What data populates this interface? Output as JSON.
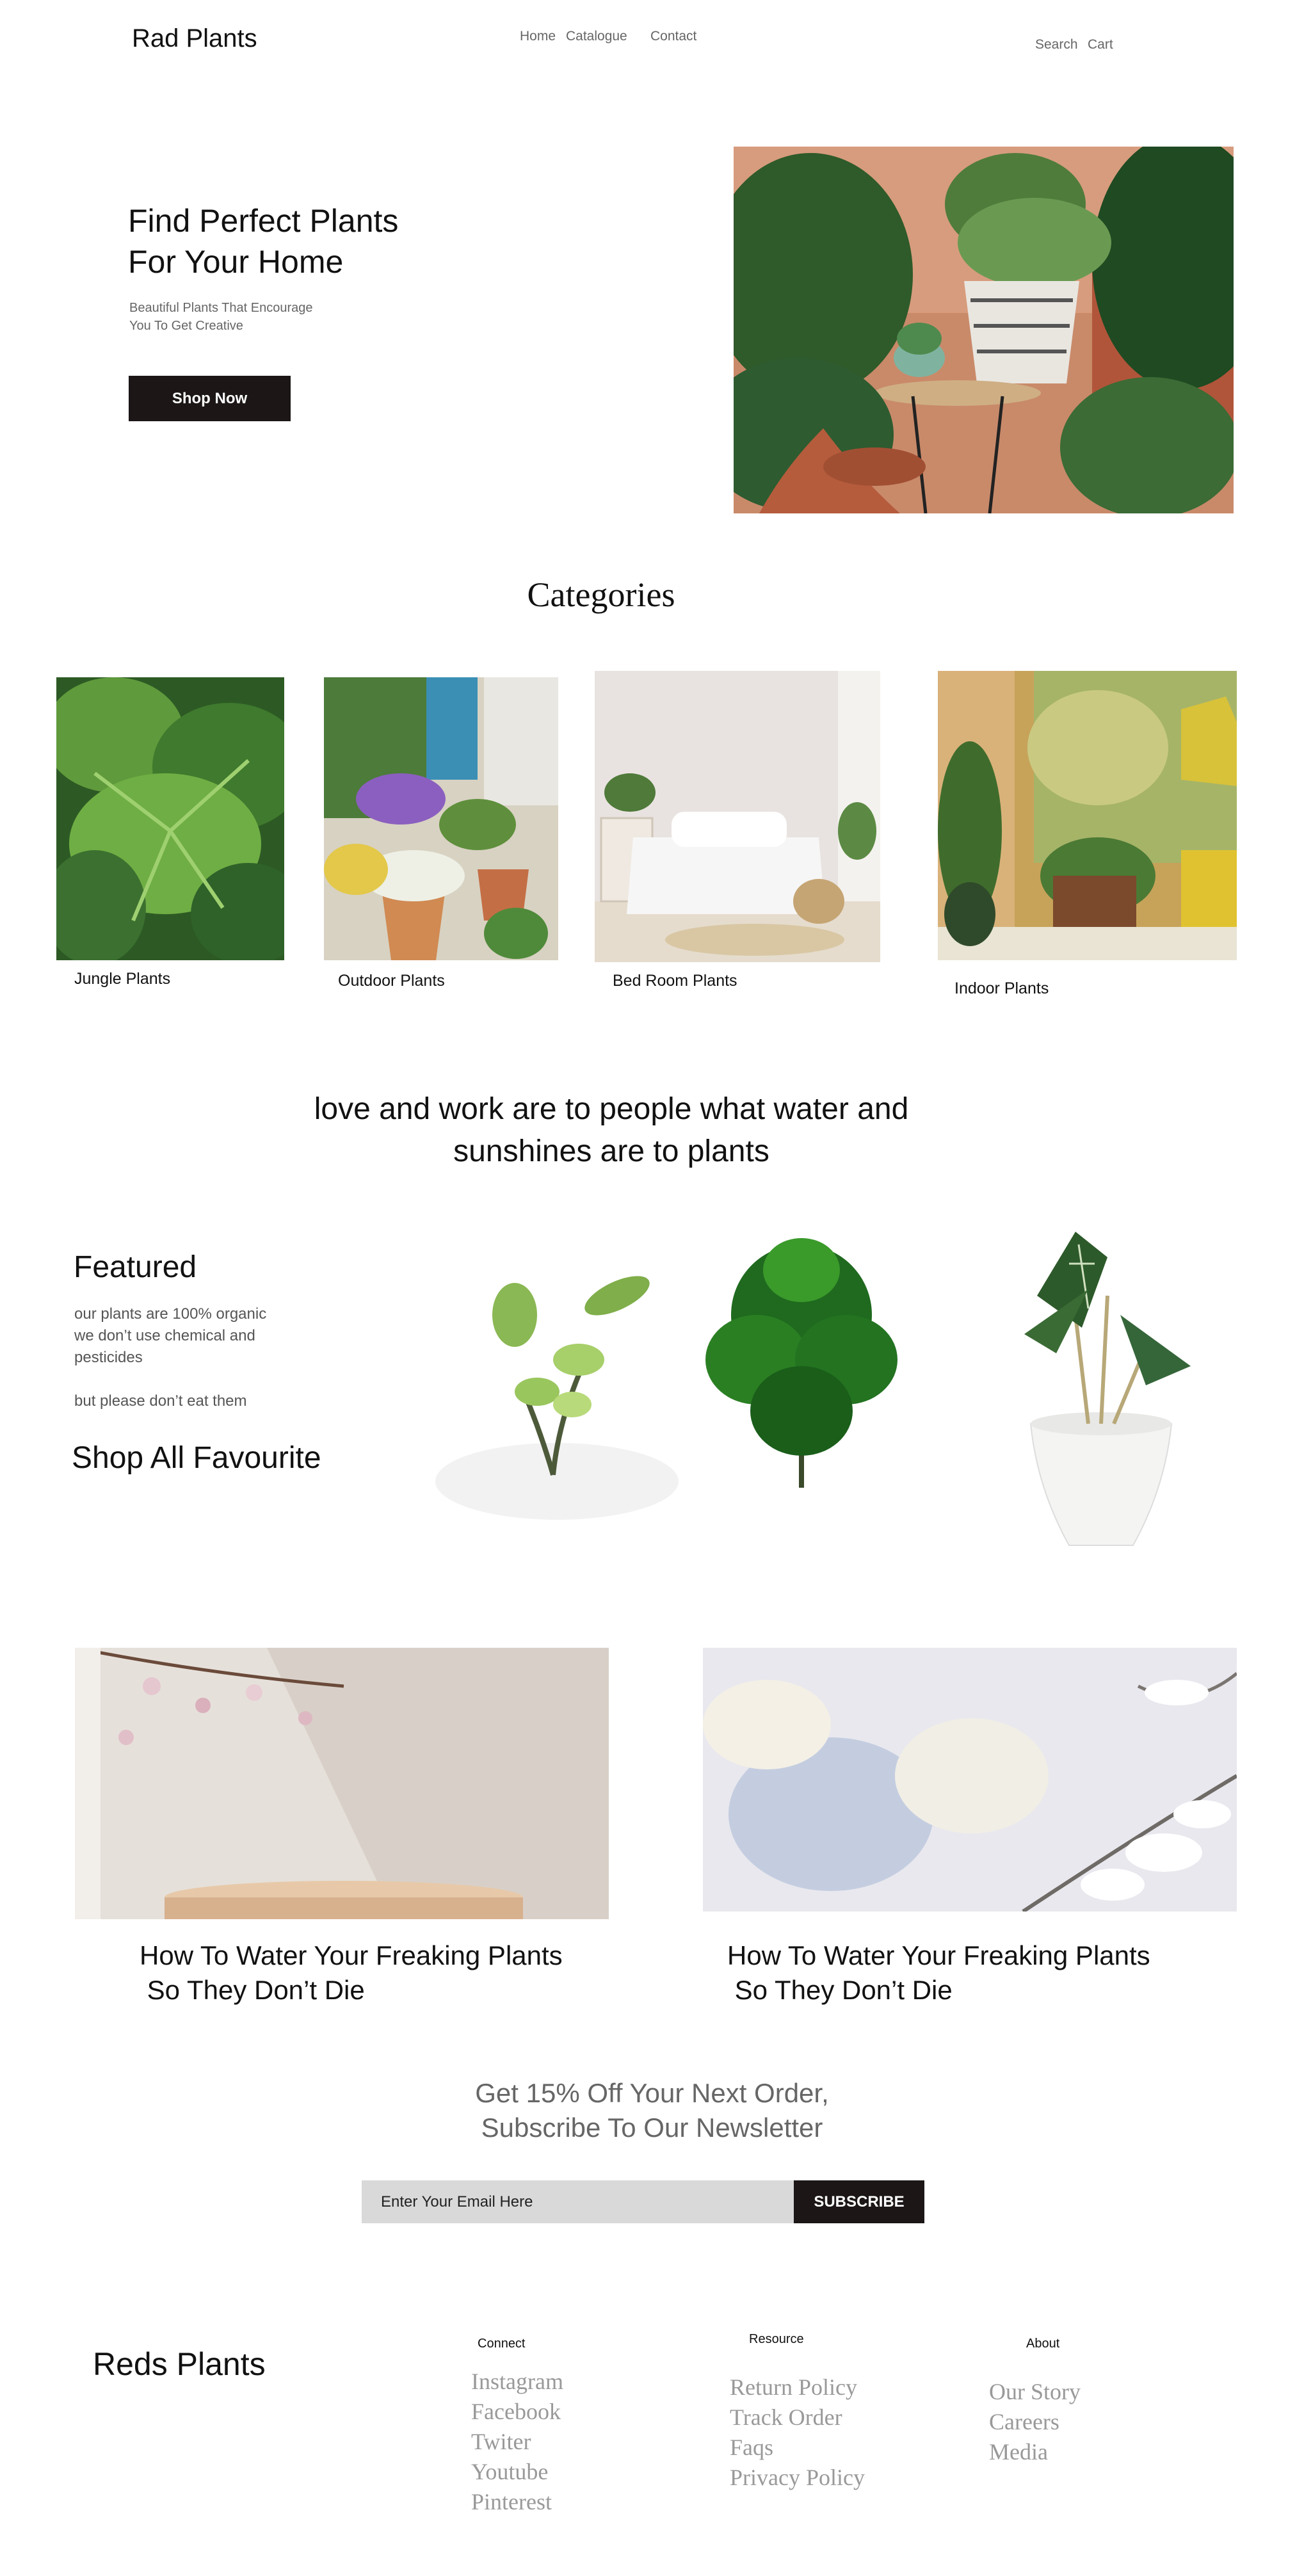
{
  "header": {
    "brand": "Rad Plants",
    "nav": [
      "Home",
      "Catalogue",
      "Contact"
    ],
    "search": "Search",
    "cart": "Cart"
  },
  "hero": {
    "title_line1": "Find Perfect Plants",
    "title_line2": "For Your Home",
    "subtitle_line1": "Beautiful Plants That Encourage",
    "subtitle_line2": "You To Get Creative",
    "button": "Shop Now"
  },
  "categories": {
    "heading": "Categories",
    "items": [
      "Jungle Plants",
      "Outdoor Plants",
      "Bed Room Plants",
      "Indoor Plants"
    ]
  },
  "quote": {
    "line1": "love and work  are to people what water and",
    "line2": "sunshines are to plants"
  },
  "featured": {
    "title": "Featured",
    "text_line1": "our plants are 100%  organic",
    "text_line2": "we don’t use chemical and",
    "text_line3": "pesticides",
    "text_line4": "but please don’t eat them",
    "shop_all": "Shop All Favourite"
  },
  "blog": {
    "posts": [
      {
        "title": "How To Water Your Freaking Plants\n So They Don’t Die"
      },
      {
        "title": "How To Water Your Freaking Plants\n So They Don’t Die"
      }
    ]
  },
  "newsletter": {
    "line1": "Get 15% Off Your Next Order,",
    "line2": "Subscribe To Our Newsletter",
    "placeholder": "Enter Your Email Here",
    "button": "SUBSCRIBE"
  },
  "footer": {
    "brand": "Reds Plants",
    "connect": {
      "heading": "Connect",
      "links": [
        "Instagram",
        "Facebook",
        "Twiter",
        "Youtube",
        "Pinterest"
      ]
    },
    "resource": {
      "heading": "Resource",
      "links": [
        "Return Policy",
        "Track Order",
        "Faqs",
        "Privacy Policy"
      ]
    },
    "about": {
      "heading": "About",
      "links": [
        "Our Story",
        "Careers",
        "Media"
      ]
    }
  },
  "colors": {
    "dark_button": "#1c1616",
    "input_bg": "#d9d9d9",
    "muted_text": "#999999"
  }
}
